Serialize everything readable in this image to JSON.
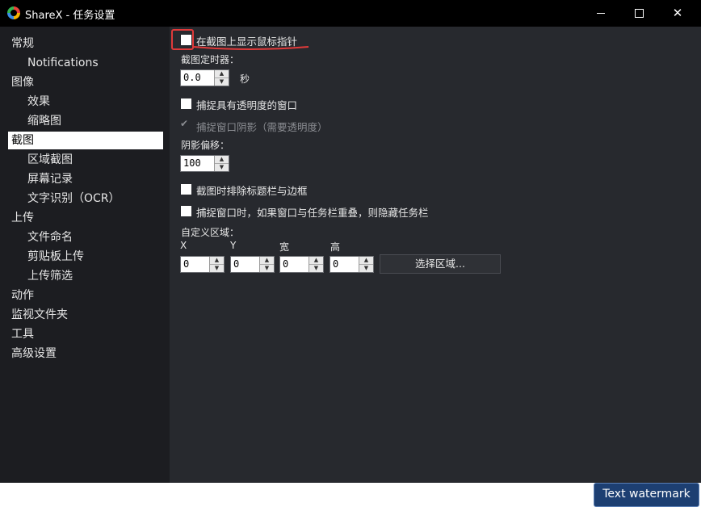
{
  "window": {
    "title": "ShareX - 任务设置",
    "controls": [
      "minimize",
      "maximize",
      "close"
    ]
  },
  "sidebar": {
    "items": [
      {
        "label": "常规",
        "level": 0
      },
      {
        "label": "Notifications",
        "level": 1
      },
      {
        "label": "图像",
        "level": 0
      },
      {
        "label": "效果",
        "level": 1
      },
      {
        "label": "缩略图",
        "level": 1
      },
      {
        "label": "截图",
        "level": 0,
        "selected": true
      },
      {
        "label": "区域截图",
        "level": 1
      },
      {
        "label": "屏幕记录",
        "level": 1
      },
      {
        "label": "文字识别（OCR）",
        "level": 1
      },
      {
        "label": "上传",
        "level": 0
      },
      {
        "label": "文件命名",
        "level": 1
      },
      {
        "label": "剪贴板上传",
        "level": 1
      },
      {
        "label": "上传筛选",
        "level": 1
      },
      {
        "label": "动作",
        "level": 0
      },
      {
        "label": "监视文件夹",
        "level": 0
      },
      {
        "label": "工具",
        "level": 0
      },
      {
        "label": "高级设置",
        "level": 0
      }
    ]
  },
  "main": {
    "show_cursor": {
      "label": "在截图上显示鼠标指针",
      "checked": false
    },
    "timer": {
      "label": "截图定时器：",
      "value": "0.0",
      "unit": "秒"
    },
    "capture_transparent": {
      "label": "捕捉具有透明度的窗口",
      "checked": false
    },
    "capture_shadow": {
      "label": "捕捉窗口阴影（需要透明度）",
      "checked": true,
      "disabled": true
    },
    "shadow_offset": {
      "label": "阴影偏移：",
      "value": "100"
    },
    "exclude_titlebar": {
      "label": "截图时排除标题栏与边框",
      "checked": false
    },
    "hide_taskbar": {
      "label": "捕捉窗口时，如果窗口与任务栏重叠，则隐藏任务栏",
      "checked": false
    },
    "custom_region": {
      "label": "自定义区域：",
      "x_label": "X",
      "y_label": "Y",
      "w_label": "宽",
      "h_label": "高",
      "x": "0",
      "y": "0",
      "w": "0",
      "h": "0",
      "select_button": "选择区域..."
    }
  },
  "overlay": {
    "watermark": "Text watermark",
    "highlight_color": "#e03a3a"
  }
}
